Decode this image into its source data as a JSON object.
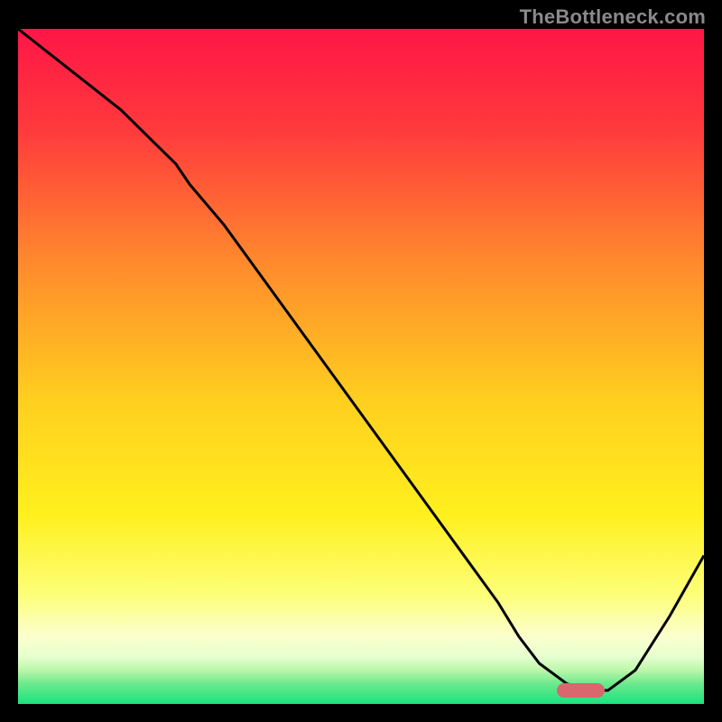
{
  "watermark": "TheBottleneck.com",
  "colors": {
    "frame": "#000000",
    "curve": "#000000",
    "marker": "#d9676d",
    "gradient_stops": [
      {
        "pct": 0,
        "color": "#ff1646"
      },
      {
        "pct": 15,
        "color": "#ff3a3d"
      },
      {
        "pct": 35,
        "color": "#ff8b2c"
      },
      {
        "pct": 55,
        "color": "#ffcf1f"
      },
      {
        "pct": 72,
        "color": "#fff01e"
      },
      {
        "pct": 84,
        "color": "#fdff7a"
      },
      {
        "pct": 90,
        "color": "#fbffce"
      },
      {
        "pct": 93,
        "color": "#e6ffcf"
      },
      {
        "pct": 95,
        "color": "#bcf7a9"
      },
      {
        "pct": 97,
        "color": "#6de98d"
      },
      {
        "pct": 100,
        "color": "#19e37e"
      }
    ]
  },
  "chart_data": {
    "type": "line",
    "title": "",
    "xlabel": "",
    "ylabel": "",
    "xlim": [
      0,
      100
    ],
    "ylim": [
      0,
      100
    ],
    "series": [
      {
        "name": "bottleneck-curve",
        "x": [
          0,
          5,
          10,
          15,
          20,
          23,
          25,
          30,
          35,
          40,
          45,
          50,
          55,
          60,
          65,
          70,
          73,
          76,
          80,
          83,
          86,
          90,
          95,
          100
        ],
        "values": [
          100,
          96,
          92,
          88,
          83,
          80,
          77,
          71,
          64,
          57,
          50,
          43,
          36,
          29,
          22,
          15,
          10,
          6,
          3,
          2,
          2,
          5,
          13,
          22
        ]
      }
    ],
    "marker": {
      "x_start": 78.5,
      "x_end": 85.5,
      "y": 2
    }
  }
}
